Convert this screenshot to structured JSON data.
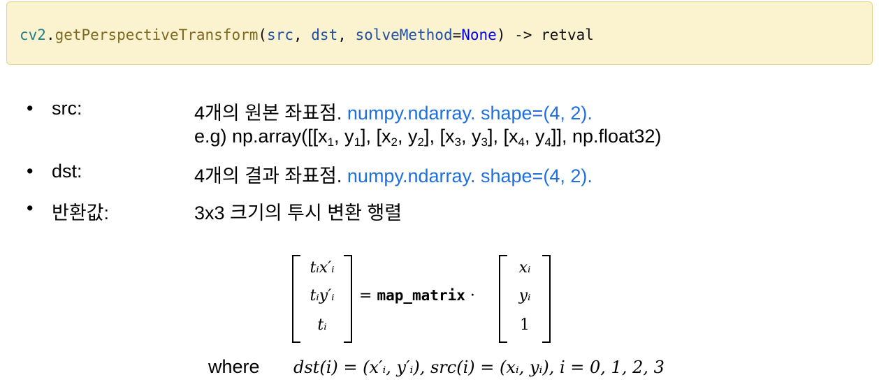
{
  "signature": {
    "module": "cv2",
    "dot": ".",
    "function": "getPerspectiveTransform",
    "open_paren": "(",
    "arg1": "src",
    "sep1": ", ",
    "arg2": "dst",
    "sep2": ", ",
    "arg3": "solveMethod",
    "equals": "=",
    "default": "None",
    "close_paren": ")",
    "arrow": " -> ",
    "return": "retval"
  },
  "params": [
    {
      "bullet": "•",
      "name": "src:",
      "desc": "4개의 원본 좌표점. ",
      "type": "numpy.ndarray. shape=(4, 2)."
    },
    {
      "bullet": "•",
      "name": "dst:",
      "desc": "4개의 결과 좌표점. ",
      "type": "numpy.ndarray. shape=(4, 2)."
    },
    {
      "bullet": "•",
      "name": "반환값:",
      "desc": "3x3 크기의 투시 변환 행렬"
    }
  ],
  "example": {
    "prefix": "e.g) np.array([[x",
    "s1": "1",
    "m1": ", y",
    "s1b": "1",
    "m2": "], [x",
    "s2": "2",
    "m3": ", y",
    "s2b": "2",
    "m4": "], [x",
    "s3": "3",
    "m5": ", y",
    "s3b": "3",
    "m6": "], [x",
    "s4": "4",
    "m7": ", y",
    "s4b": "4",
    "suffix": "]], np.float32)"
  },
  "equation": {
    "lhs": [
      "tᵢx′ᵢ",
      "tᵢy′ᵢ",
      "tᵢ"
    ],
    "middle": "= ",
    "operator_name": "map_matrix",
    "dot": " ·",
    "rhs": [
      "xᵢ",
      "yᵢ",
      "1"
    ]
  },
  "where": {
    "label": "where",
    "formula": "dst(i) = (x′ᵢ, y′ᵢ), src(i) = (xᵢ, yᵢ), i = 0, 1, 2, 3"
  }
}
